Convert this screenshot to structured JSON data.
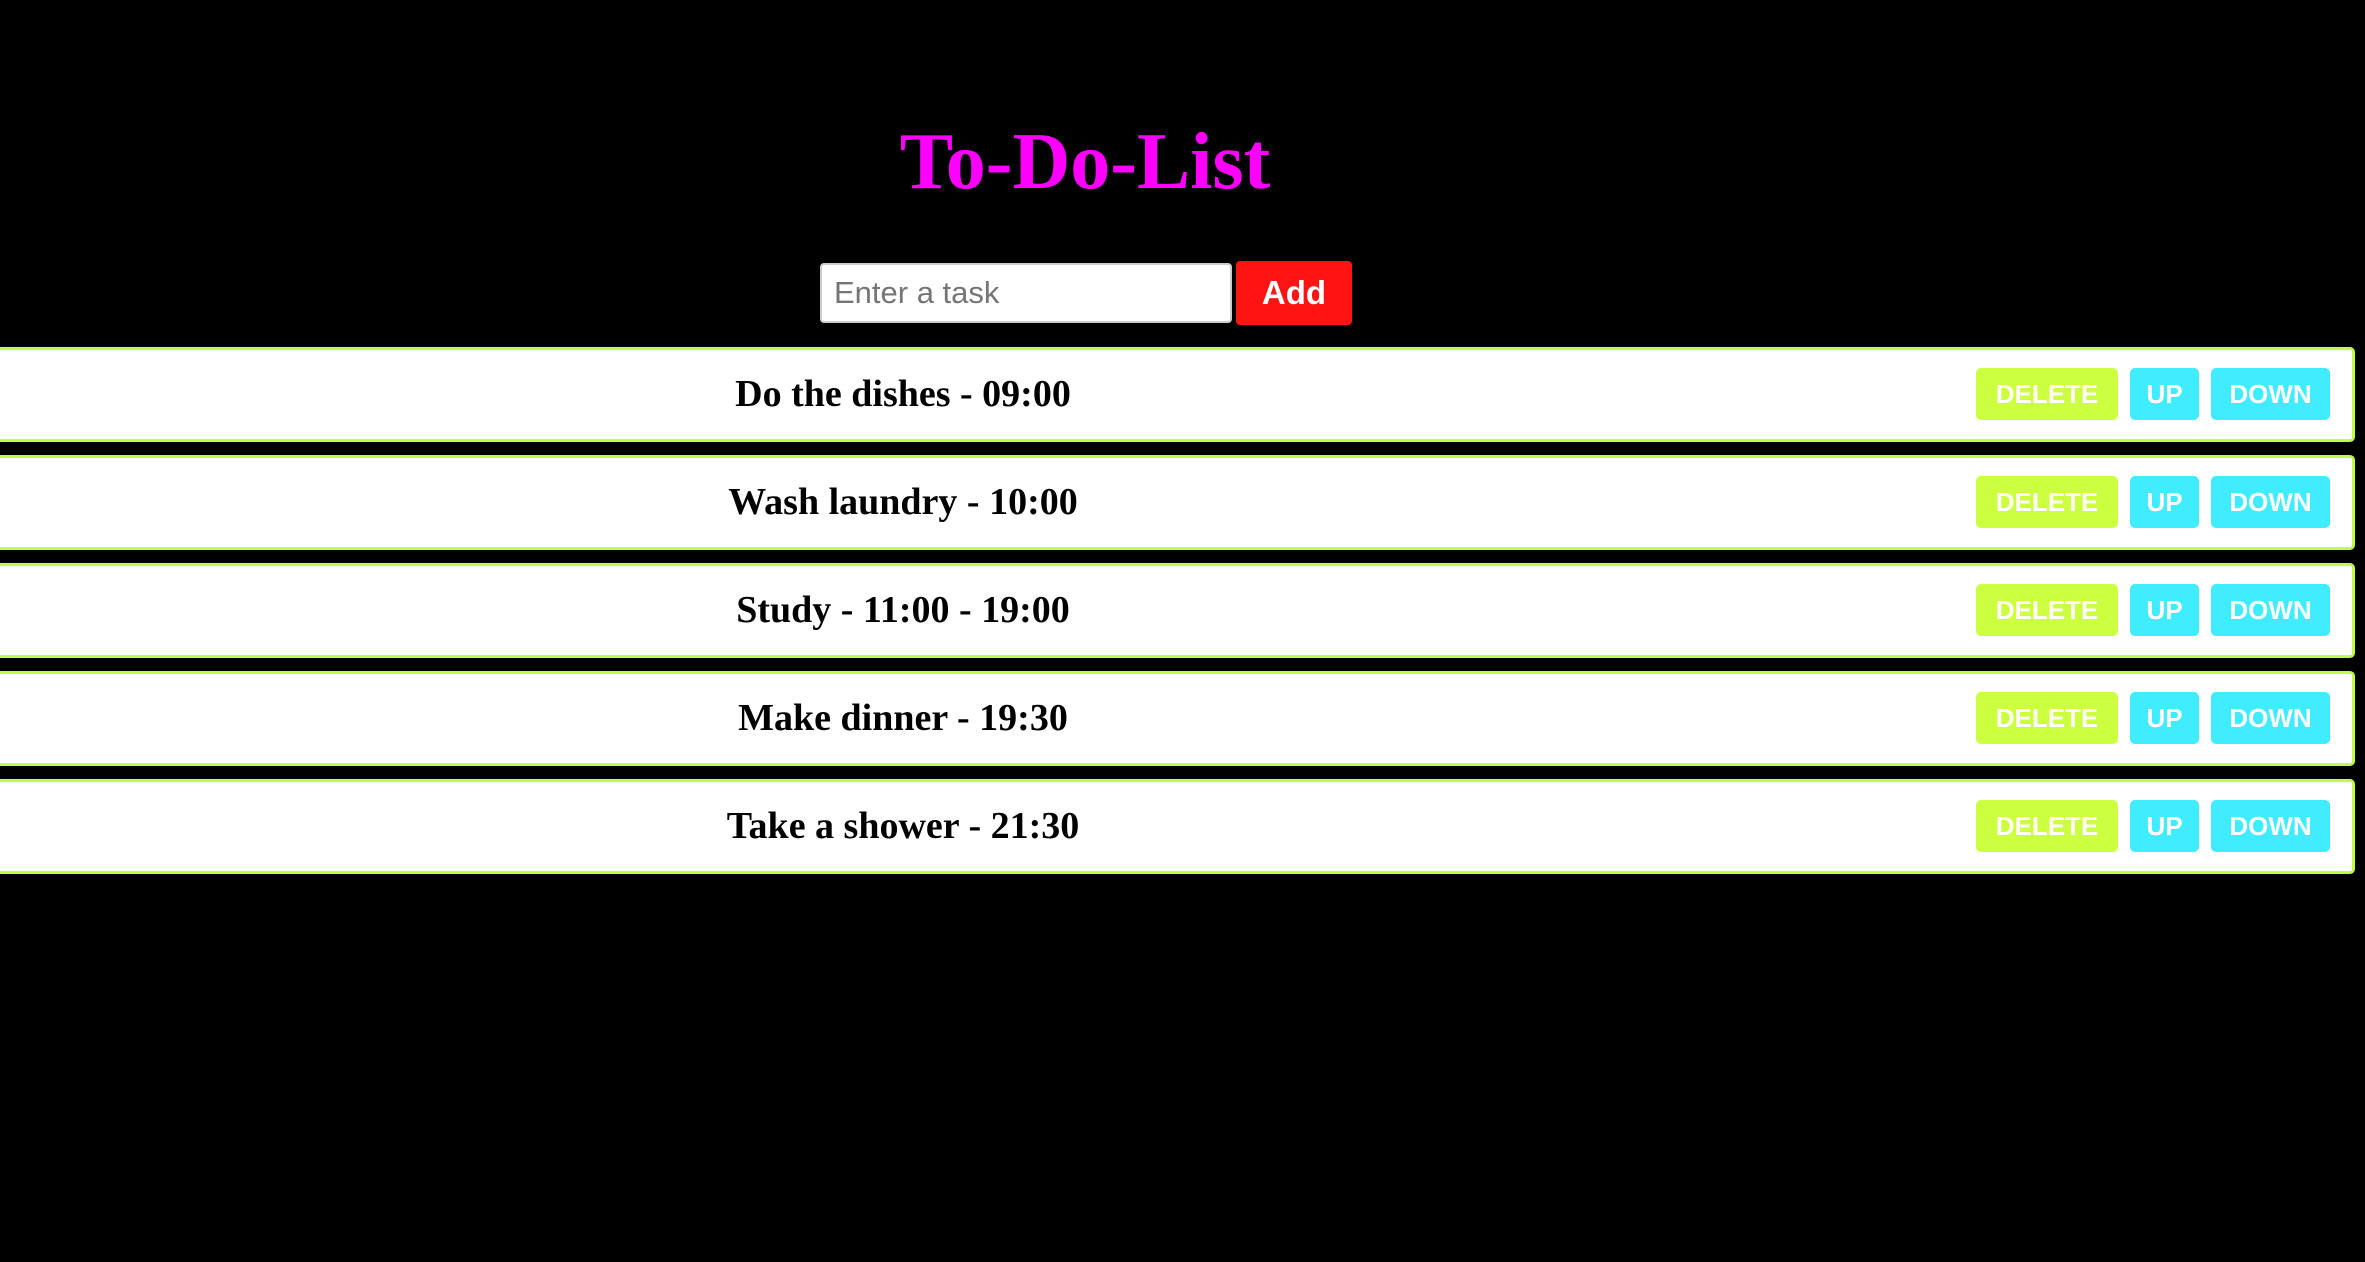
{
  "app": {
    "title": "To-Do-List"
  },
  "input": {
    "placeholder": "Enter a task",
    "value": ""
  },
  "add_button": {
    "label": "Add"
  },
  "task_buttons": {
    "delete_label": "DELETE",
    "up_label": "UP",
    "down_label": "DOWN"
  },
  "tasks": [
    {
      "text": "Do the dishes - 09:00"
    },
    {
      "text": "Wash laundry - 10:00"
    },
    {
      "text": "Study - 11:00 - 19:00"
    },
    {
      "text": "Make dinner - 19:30"
    },
    {
      "text": "Take a shower - 21:30"
    }
  ],
  "colors": {
    "background": "#000000",
    "title": "#ff00ff",
    "add_button": "#ff1414",
    "delete_button": "#ccff40",
    "move_buttons": "#40ecff",
    "row_border": "#bfff3f"
  }
}
